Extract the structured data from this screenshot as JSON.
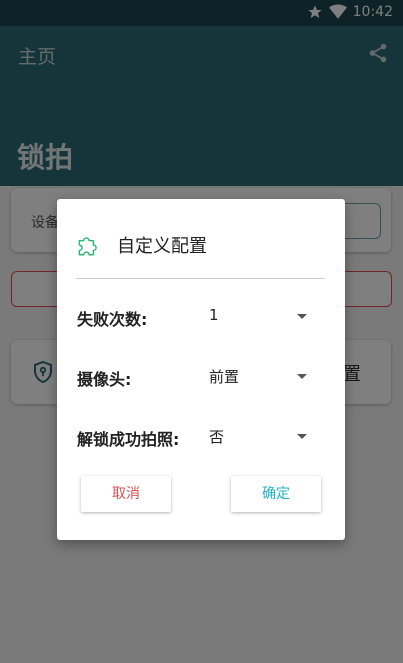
{
  "status_bar": {
    "time": "10:42",
    "icons": [
      "star-icon",
      "wifi-icon"
    ]
  },
  "appbar": {
    "title": "主页",
    "heading": "锁拍",
    "action_icon": "share-icon"
  },
  "background": {
    "device_card": {
      "label": "设备",
      "button_label": ""
    },
    "config_card": {
      "icon": "shield-icon",
      "label": "置"
    }
  },
  "dialog": {
    "title": "自定义配置",
    "title_icon": "puzzle-icon",
    "rows": [
      {
        "label": "失败次数:",
        "value": "1"
      },
      {
        "label": "摄像头:",
        "value": "前置"
      },
      {
        "label": "解锁成功拍照:",
        "value": "否"
      }
    ],
    "cancel_label": "取消",
    "confirm_label": "确定"
  },
  "colors": {
    "primary": "#2a6a77",
    "cancel": "#e04d4d",
    "confirm": "#20b5c9",
    "alert_outline": "#e24b4b"
  }
}
